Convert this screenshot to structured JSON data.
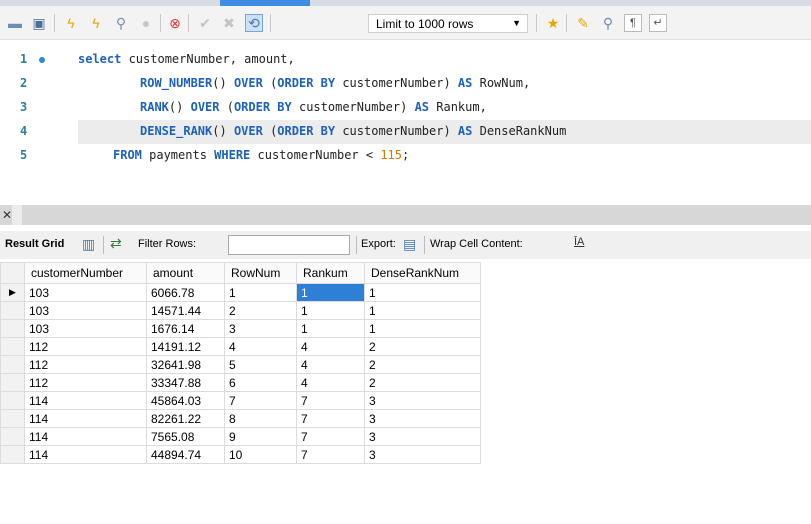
{
  "toolbar": {
    "limit_label": "Limit to 1000 rows",
    "icons": [
      "open-folder-icon",
      "save-icon",
      "execute-icon",
      "execute-current-icon",
      "explain-icon",
      "stop-icon",
      "toggle-error-icon",
      "commit-icon",
      "rollback-icon",
      "autocommit-icon",
      "bookmark-icon",
      "beautify-icon",
      "find-icon",
      "invisible-chars-icon",
      "wrap-icon"
    ]
  },
  "editor": {
    "lines": [
      {
        "num": "1",
        "segments": [
          [
            "kw",
            "select "
          ],
          [
            "tx",
            "customerNumber, amount,"
          ]
        ]
      },
      {
        "num": "2",
        "segments": [
          [
            "fn",
            "ROW_NUMBER"
          ],
          [
            "tx",
            "() "
          ],
          [
            "kw",
            "OVER"
          ],
          [
            "tx",
            " ("
          ],
          [
            "kw",
            "ORDER BY"
          ],
          [
            "tx",
            " customerNumber) "
          ],
          [
            "kw",
            "AS"
          ],
          [
            "tx",
            " RowNum,"
          ]
        ]
      },
      {
        "num": "3",
        "segments": [
          [
            "fn",
            "RANK"
          ],
          [
            "tx",
            "() "
          ],
          [
            "kw",
            "OVER"
          ],
          [
            "tx",
            " ("
          ],
          [
            "kw",
            "ORDER BY"
          ],
          [
            "tx",
            " customerNumber) "
          ],
          [
            "kw",
            "AS"
          ],
          [
            "tx",
            " Rankum,"
          ]
        ]
      },
      {
        "num": "4",
        "segments": [
          [
            "fn",
            "DENSE_RANK"
          ],
          [
            "tx",
            "() "
          ],
          [
            "kw",
            "OVER"
          ],
          [
            "tx",
            " ("
          ],
          [
            "kw",
            "ORDER BY"
          ],
          [
            "tx",
            " customerNumber) "
          ],
          [
            "kw",
            "AS"
          ],
          [
            "tx",
            " DenseRankNum"
          ]
        ]
      },
      {
        "num": "5",
        "segments": [
          [
            "kw",
            "FROM"
          ],
          [
            "tx",
            " payments "
          ],
          [
            "kw",
            "WHERE"
          ],
          [
            "tx",
            " customerNumber < "
          ],
          [
            "num",
            "115"
          ],
          [
            "tx",
            ";"
          ]
        ]
      }
    ]
  },
  "results": {
    "result_grid_label": "Result Grid",
    "filter_rows_label": "Filter Rows:",
    "filter_value": "",
    "export_label": "Export:",
    "wrap_label": "Wrap Cell Content:",
    "columns": [
      "customerNumber",
      "amount",
      "RowNum",
      "Rankum",
      "DenseRankNum"
    ],
    "rows": [
      [
        "103",
        "6066.78",
        "1",
        "1",
        "1"
      ],
      [
        "103",
        "14571.44",
        "2",
        "1",
        "1"
      ],
      [
        "103",
        "1676.14",
        "3",
        "1",
        "1"
      ],
      [
        "112",
        "14191.12",
        "4",
        "4",
        "2"
      ],
      [
        "112",
        "32641.98",
        "5",
        "4",
        "2"
      ],
      [
        "112",
        "33347.88",
        "6",
        "4",
        "2"
      ],
      [
        "114",
        "45864.03",
        "7",
        "7",
        "3"
      ],
      [
        "114",
        "82261.22",
        "8",
        "7",
        "3"
      ],
      [
        "114",
        "7565.08",
        "9",
        "7",
        "3"
      ],
      [
        "114",
        "44894.74",
        "10",
        "7",
        "3"
      ]
    ],
    "selected_row": 0,
    "selected_col": 3
  }
}
